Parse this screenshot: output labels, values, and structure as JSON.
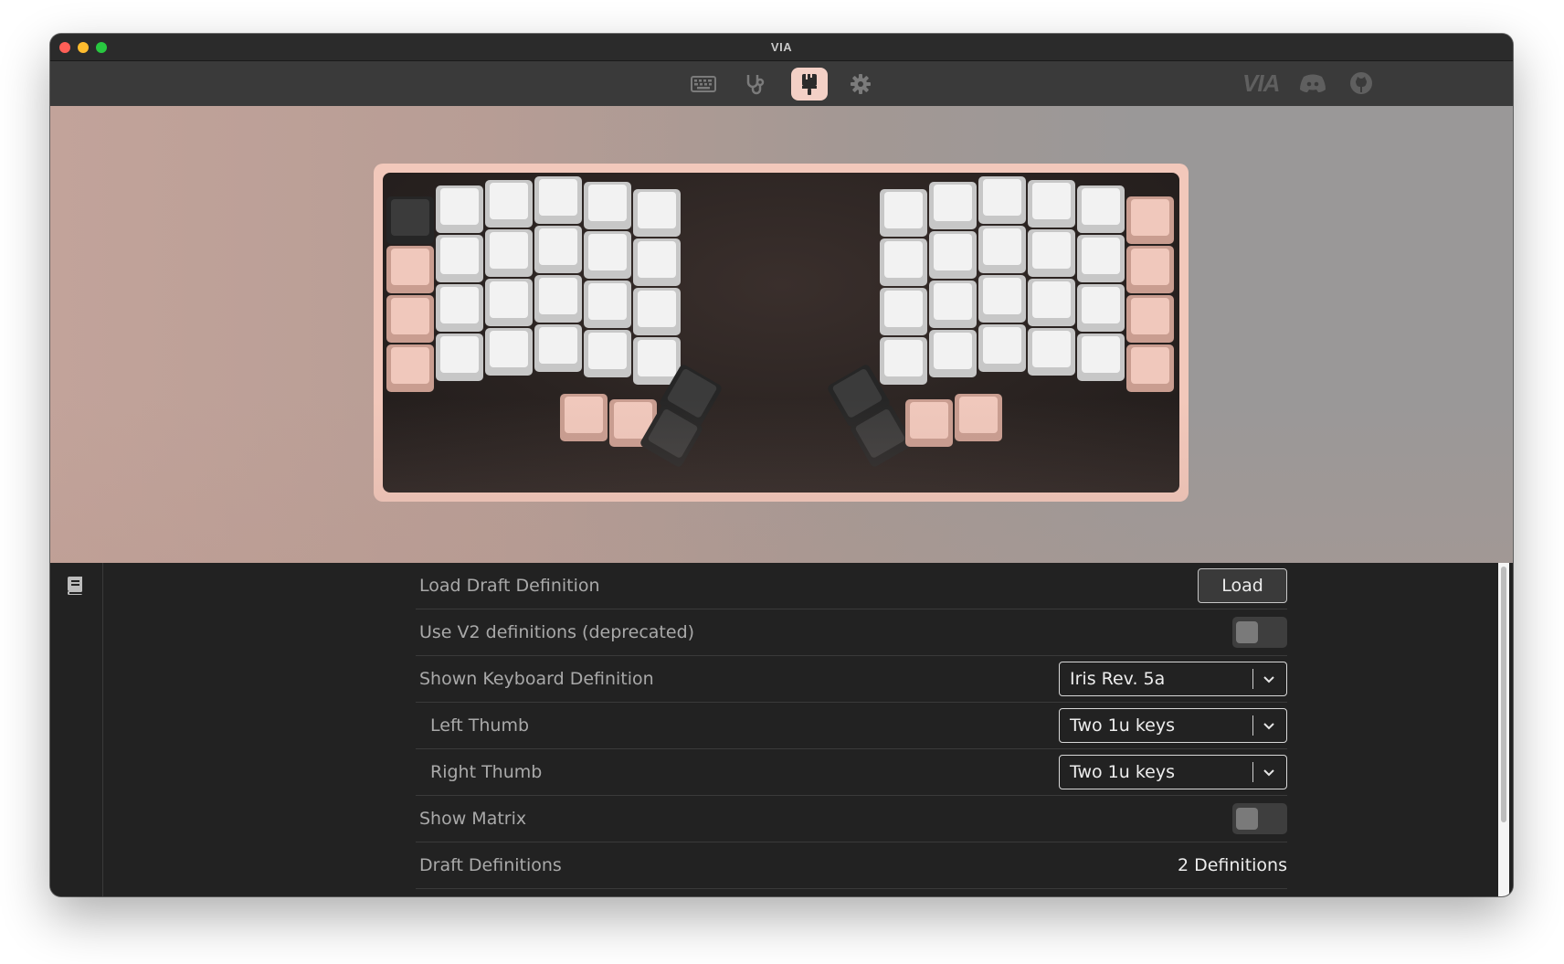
{
  "window": {
    "title": "VIA"
  },
  "topnav": {
    "tabs": [
      {
        "icon": "keyboard-icon",
        "active": false
      },
      {
        "icon": "stethoscope-icon",
        "active": false
      },
      {
        "icon": "paintbrush-icon",
        "active": true
      },
      {
        "icon": "gear-icon",
        "active": false
      }
    ],
    "right_icons": [
      "via-logo",
      "discord-icon",
      "github-icon"
    ],
    "via_logo_text": "VIA"
  },
  "keyboard_preview": {
    "colors": {
      "case": "#f2c8bb",
      "alpha_keys": "#f2f2f2",
      "mod_keys": "#f0c8bc",
      "dark_keys": "#3b3b3b"
    }
  },
  "sidebar": {
    "icons": [
      "book-icon"
    ]
  },
  "settings": {
    "load_draft": {
      "label": "Load Draft Definition",
      "button": "Load"
    },
    "use_v2": {
      "label": "Use V2 definitions (deprecated)",
      "value": false
    },
    "shown_definition": {
      "label": "Shown Keyboard Definition",
      "value": "Iris Rev. 5a"
    },
    "left_thumb": {
      "label": "Left Thumb",
      "value": "Two 1u keys"
    },
    "right_thumb": {
      "label": "Right Thumb",
      "value": "Two 1u keys"
    },
    "show_matrix": {
      "label": "Show Matrix",
      "value": false
    },
    "draft_definitions": {
      "label": "Draft Definitions",
      "value": "2 Definitions"
    }
  }
}
